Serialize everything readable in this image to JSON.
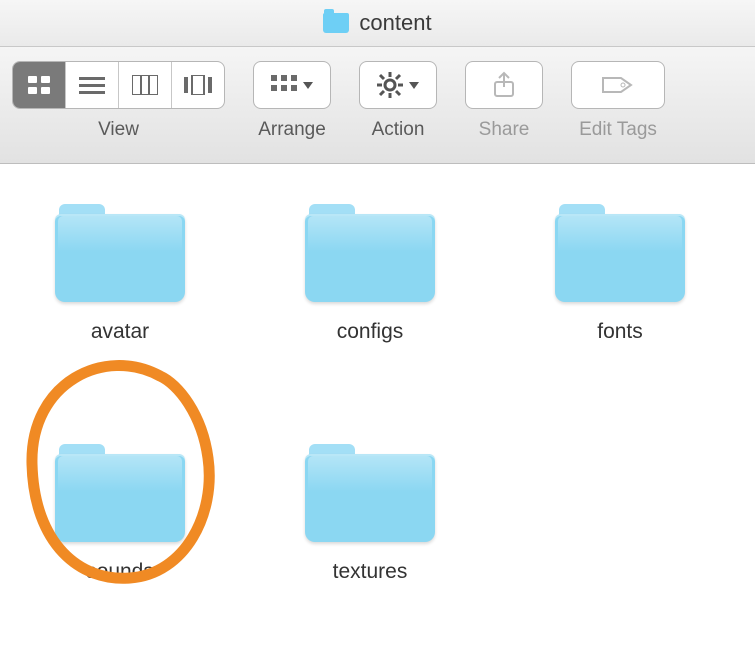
{
  "window": {
    "title": "content"
  },
  "toolbar": {
    "view_label": "View",
    "arrange_label": "Arrange",
    "action_label": "Action",
    "share_label": "Share",
    "edit_tags_label": "Edit Tags"
  },
  "folders": [
    {
      "name": "avatar"
    },
    {
      "name": "configs"
    },
    {
      "name": "fonts"
    },
    {
      "name": "sounds",
      "highlighted": true
    },
    {
      "name": "textures"
    }
  ]
}
